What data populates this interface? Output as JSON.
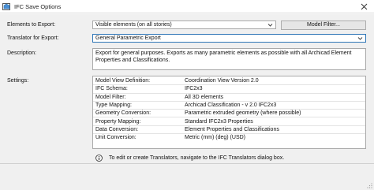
{
  "window": {
    "title": "IFC Save Options",
    "app_icon": "ifc-app-icon",
    "close_icon": "close-icon"
  },
  "form": {
    "elements_label": "Elements to Export:",
    "elements_value": "Visible elements (on all stories)",
    "model_filter_button": "Model Filter...",
    "translator_label": "Translator for Export:",
    "translator_value": "General Parametric Export",
    "description_label": "Description:",
    "description_text": "Export for general purposes. Exports as many parametric elements as possible with all Archicad Element Properties and Classifications.",
    "settings_label": "Settings:"
  },
  "settings": [
    {
      "key": "Model View Definition:",
      "value": "Coordination View Version 2.0"
    },
    {
      "key": "IFC Schema:",
      "value": "IFC2x3"
    },
    {
      "key": "Model Filter:",
      "value": "All 3D elements"
    },
    {
      "key": "Type Mapping:",
      "value": "Archicad Classification - v 2.0 IFC2x3"
    },
    {
      "key": "Geometry Conversion:",
      "value": "Parametric extruded geometry (where possible)"
    },
    {
      "key": "Property Mapping:",
      "value": "Standard IFC2x3 Properties"
    },
    {
      "key": "Data Conversion:",
      "value": "Element Properties and Classifications"
    },
    {
      "key": "Unit Conversion:",
      "value": "Metric (mm) (deg) (USD)"
    }
  ],
  "info": {
    "icon": "info-icon",
    "text": "To edit or create Translators, navigate to the IFC Translators dialog box."
  },
  "colors": {
    "accent": "#2e75b6",
    "border": "#a9a9a9",
    "panel": "#f0f0f0"
  }
}
